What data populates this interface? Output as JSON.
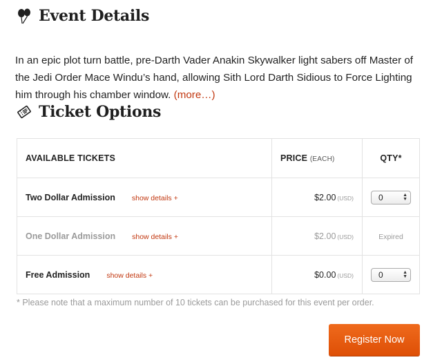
{
  "event_section": {
    "title": "Event Details",
    "icon": "balloons-icon",
    "description": "In an epic plot turn battle, pre-Darth Vader Anakin Skywalker light sabers off Master of the Jedi Order Mace Windu’s hand, allowing Sith Lord Darth Sidious to Force Lighting him through his chamber window.",
    "more_label": "(more…)"
  },
  "tickets_section": {
    "title": "Ticket Options",
    "icon": "ticket-icon",
    "columns": {
      "available": "AVAILABLE TICKETS",
      "price": "PRICE",
      "price_each": "(EACH)",
      "qty": "QTY*"
    },
    "rows": [
      {
        "name": "Two Dollar Admission",
        "details_label": "show details +",
        "price": "$2.00",
        "currency": "(USD)",
        "qty": "0",
        "expired": false
      },
      {
        "name": "One Dollar Admission",
        "details_label": "show details +",
        "price": "$2.00",
        "currency": "(USD)",
        "status": "Expired",
        "expired": true
      },
      {
        "name": "Free Admission",
        "details_label": "show details +",
        "price": "$0.00",
        "currency": "(USD)",
        "qty": "0",
        "expired": false
      }
    ],
    "note": "* Please note that a maximum number of 10 tickets can be purchased for this event per order."
  },
  "register_button": "Register Now",
  "colors": {
    "accent": "#c1360e",
    "button": "#e95d13",
    "muted": "#9a9a9a"
  }
}
